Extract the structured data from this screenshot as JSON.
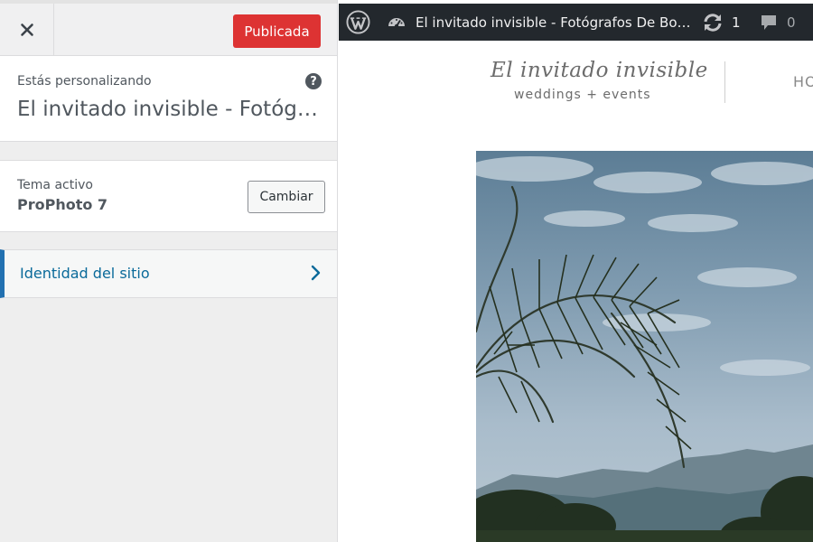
{
  "sidebar": {
    "close_icon": "close-icon",
    "publish_label": "Publicada",
    "publish_color": "#dd3333",
    "customizing_label": "Estás personalizando",
    "help_icon": "help-icon",
    "help_glyph": "?",
    "site_title": "El invitado invisible - Fotógrafos De Bo…",
    "theme": {
      "label": "Tema activo",
      "name": "ProPhoto 7",
      "change_label": "Cambiar"
    },
    "sections": [
      {
        "label": "Identidad del sitio",
        "icon": "chevron-right-icon"
      }
    ],
    "accent_color": "#2271b1"
  },
  "preview": {
    "adminbar": {
      "logo_icon": "wordpress-logo-icon",
      "dashboard_icon": "dashboard-icon",
      "site_name": "El invitado invisible - Fotógrafos De Bo…",
      "updates_icon": "updates-icon",
      "updates_count": "1",
      "comments_icon": "comments-icon",
      "comments_count": "0"
    },
    "header": {
      "logo_title": "El invitado invisible",
      "logo_tagline": "weddings + events",
      "nav_home": "HO"
    },
    "hero_image": "palm-tree-lake-photo"
  }
}
